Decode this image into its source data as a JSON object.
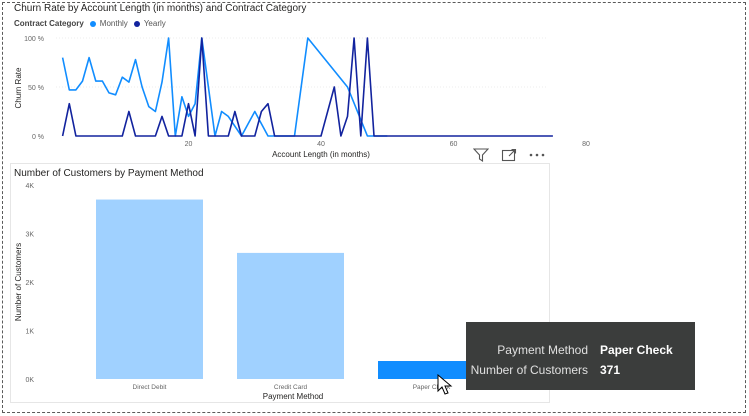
{
  "line_visual": {
    "title": "Churn Rate by Account Length (in months) and Contract Category",
    "legend_label": "Contract Category",
    "legend_items": [
      {
        "name": "Monthly",
        "color": "#118DFF"
      },
      {
        "name": "Yearly",
        "color": "#12239E"
      }
    ]
  },
  "bar_visual": {
    "title": "Number of Customers by Payment Method"
  },
  "toolbar": {
    "icons": [
      "filter-icon",
      "focus-mode-icon",
      "more-options-icon"
    ]
  },
  "tooltip": {
    "rows": [
      {
        "key": "Payment Method",
        "value": "Paper Check"
      },
      {
        "key": "Number of Customers",
        "value": "371"
      }
    ]
  },
  "chart_data": [
    {
      "type": "line",
      "title": "Churn Rate by Account Length (in months) and Contract Category",
      "xlabel": "Account Length (in months)",
      "ylabel": "Churn Rate",
      "xlim": [
        0,
        80
      ],
      "ylim": [
        0,
        100
      ],
      "xticks": [
        "20",
        "40",
        "60",
        "80"
      ],
      "yticks": [
        "0 %",
        "50 %",
        "100 %"
      ],
      "series": [
        {
          "name": "Monthly",
          "color": "#118DFF",
          "points": [
            [
              1,
              80
            ],
            [
              2,
              47
            ],
            [
              3,
              47
            ],
            [
              4,
              56
            ],
            [
              5,
              80
            ],
            [
              6,
              56
            ],
            [
              7,
              56
            ],
            [
              8,
              44
            ],
            [
              9,
              42
            ],
            [
              10,
              60
            ],
            [
              11,
              55
            ],
            [
              12,
              78
            ],
            [
              13,
              50
            ],
            [
              14,
              30
            ],
            [
              15,
              25
            ],
            [
              16,
              55
            ],
            [
              17,
              100
            ],
            [
              18,
              0
            ],
            [
              19,
              40
            ],
            [
              20,
              20
            ],
            [
              21,
              33
            ],
            [
              22,
              100
            ],
            [
              23,
              50
            ],
            [
              24,
              0
            ],
            [
              25,
              25
            ],
            [
              26,
              20
            ],
            [
              28,
              0
            ],
            [
              30,
              25
            ],
            [
              32,
              0
            ],
            [
              34,
              0
            ],
            [
              36,
              0
            ],
            [
              38,
              100
            ],
            [
              44,
              50
            ],
            [
              47,
              0
            ],
            [
              50,
              0
            ]
          ]
        },
        {
          "name": "Yearly",
          "color": "#12239E",
          "points": [
            [
              1,
              0
            ],
            [
              2,
              33
            ],
            [
              3,
              0
            ],
            [
              4,
              0
            ],
            [
              10,
              0
            ],
            [
              11,
              25
            ],
            [
              12,
              0
            ],
            [
              13,
              0
            ],
            [
              15,
              0
            ],
            [
              16,
              20
            ],
            [
              17,
              0
            ],
            [
              19,
              0
            ],
            [
              20,
              33
            ],
            [
              21,
              0
            ],
            [
              22,
              100
            ],
            [
              23,
              0
            ],
            [
              24,
              0
            ],
            [
              26,
              0
            ],
            [
              27,
              25
            ],
            [
              28,
              0
            ],
            [
              29,
              0
            ],
            [
              30,
              0
            ],
            [
              31,
              25
            ],
            [
              32,
              33
            ],
            [
              33,
              0
            ],
            [
              34,
              0
            ],
            [
              36,
              0
            ],
            [
              38,
              0
            ],
            [
              40,
              0
            ],
            [
              42,
              50
            ],
            [
              43,
              0
            ],
            [
              44,
              20
            ],
            [
              45,
              100
            ],
            [
              46,
              0
            ],
            [
              47,
              100
            ],
            [
              48,
              0
            ],
            [
              50,
              0
            ],
            [
              60,
              0
            ],
            [
              70,
              0
            ],
            [
              75,
              0
            ]
          ]
        }
      ]
    },
    {
      "type": "bar",
      "title": "Number of Customers by Payment Method",
      "xlabel": "Payment Method",
      "ylabel": "Number of Customers",
      "categories": [
        "Direct Debit",
        "Credit Card",
        "Paper Check"
      ],
      "values": [
        3700,
        2600,
        371
      ],
      "ylim": [
        0,
        4000
      ],
      "yticks": [
        "0K",
        "1K",
        "2K",
        "3K",
        "4K"
      ],
      "colors": [
        "#A0D1FF",
        "#A0D1FF",
        "#118DFF"
      ]
    }
  ]
}
